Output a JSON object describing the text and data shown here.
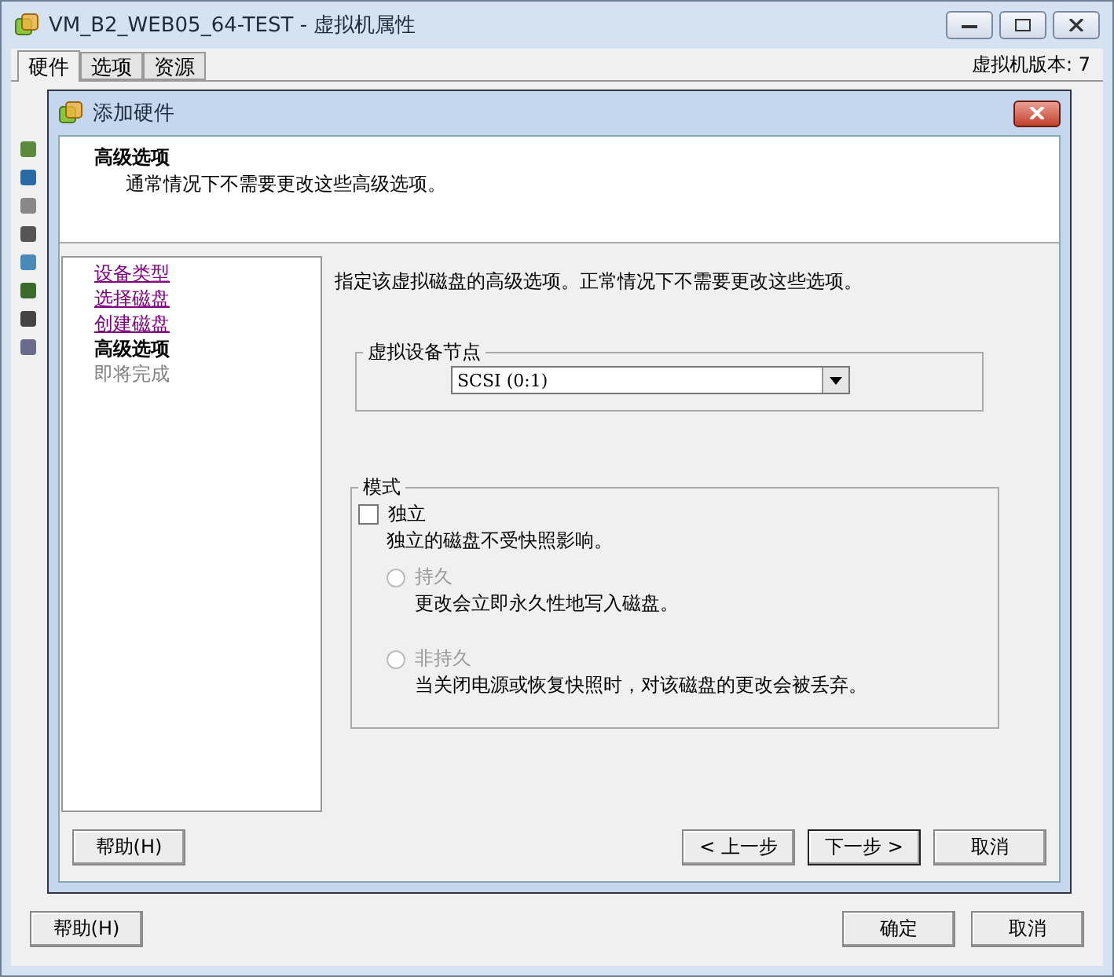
{
  "window": {
    "title": "VM_B2_WEB05_64-TEST - 虚拟机属性",
    "tabs": [
      {
        "label": "硬件",
        "selected": true
      },
      {
        "label": "选项",
        "selected": false
      },
      {
        "label": "资源",
        "selected": false
      }
    ],
    "version": "虚拟机版本: 7",
    "buttons": [
      {
        "label": "帮助(H)"
      },
      {
        "label": "确定"
      },
      {
        "label": "取消"
      }
    ]
  },
  "dialog": {
    "title": "添加硬件",
    "header": {
      "title": "高级选项",
      "subtitle": "通常情况下不需要更改这些高级选项。"
    },
    "steps": [
      {
        "label": "设备类型",
        "visited": true,
        "current": false
      },
      {
        "label": "选择磁盘",
        "visited": true,
        "current": false
      },
      {
        "label": "创建磁盘",
        "visited": true,
        "current": false
      },
      {
        "label": "高级选项",
        "visited": false,
        "current": true
      },
      {
        "label": "即将完成",
        "visited": false,
        "current": false
      }
    ],
    "intro": "指定该虚拟磁盘的高级选项。正常情况下不需要更改这些选项。",
    "node_group": {
      "label": "虚拟设备节点",
      "value": "SCSI (0:1)"
    },
    "mode_group": {
      "label": "模式",
      "independent": {
        "label": "独立",
        "checked": false,
        "description": "独立的磁盘不受快照影响。"
      },
      "options": [
        {
          "label": "持久",
          "selected": false,
          "disabled": true,
          "description": "更改会立即永久性地写入磁盘。"
        },
        {
          "label": "非持久",
          "selected": false,
          "disabled": true,
          "description": "当关闭电源或恢复快照时，对该磁盘的更改会被丢弃。"
        }
      ]
    },
    "help_button": {
      "label": "帮助(H)"
    },
    "buttons": [
      {
        "label": "< 上一步",
        "default": false
      },
      {
        "label": "下一步 >",
        "default": true
      },
      {
        "label": "取消",
        "default": false
      }
    ]
  }
}
